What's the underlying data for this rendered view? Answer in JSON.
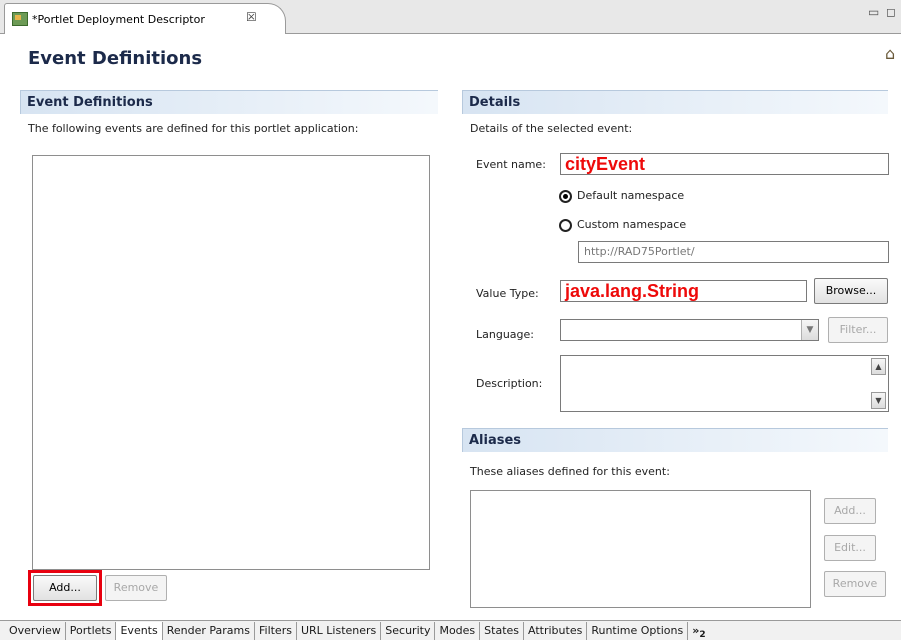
{
  "editor_tab": {
    "title": "*Portlet Deployment Descriptor",
    "close": "☒"
  },
  "window_controls": {
    "minimize": "▭",
    "maximize": "◻"
  },
  "form": {
    "title": "Event Definitions",
    "home_icon": "⌂"
  },
  "events_section": {
    "heading": "Event Definitions",
    "description": "The following events are defined for this portlet application:",
    "add_label": "Add...",
    "remove_label": "Remove"
  },
  "details_section": {
    "heading": "Details",
    "description": "Details of the selected event:",
    "event_name_label": "Event name:",
    "event_name_value": "cityEvent",
    "default_namespace_label": "Default namespace",
    "custom_namespace_label": "Custom namespace",
    "namespace_value": "http://RAD75Portlet/",
    "value_type_label": "Value Type:",
    "value_type_value": "java.lang.String",
    "browse_label": "Browse...",
    "language_label": "Language:",
    "language_value": "",
    "filter_label": "Filter...",
    "description_label": "Description:",
    "description_value": ""
  },
  "aliases_section": {
    "heading": "Aliases",
    "description": "These aliases defined for this event:",
    "add_label": "Add...",
    "edit_label": "Edit...",
    "remove_label": "Remove"
  },
  "page_tabs": [
    "Overview",
    "Portlets",
    "Events",
    "Render Params",
    "Filters",
    "URL Listeners",
    "Security",
    "Modes",
    "States",
    "Attributes",
    "Runtime Options"
  ],
  "active_page_tab": "Events",
  "more_tabs": {
    "glyph": "»",
    "count": "2"
  }
}
